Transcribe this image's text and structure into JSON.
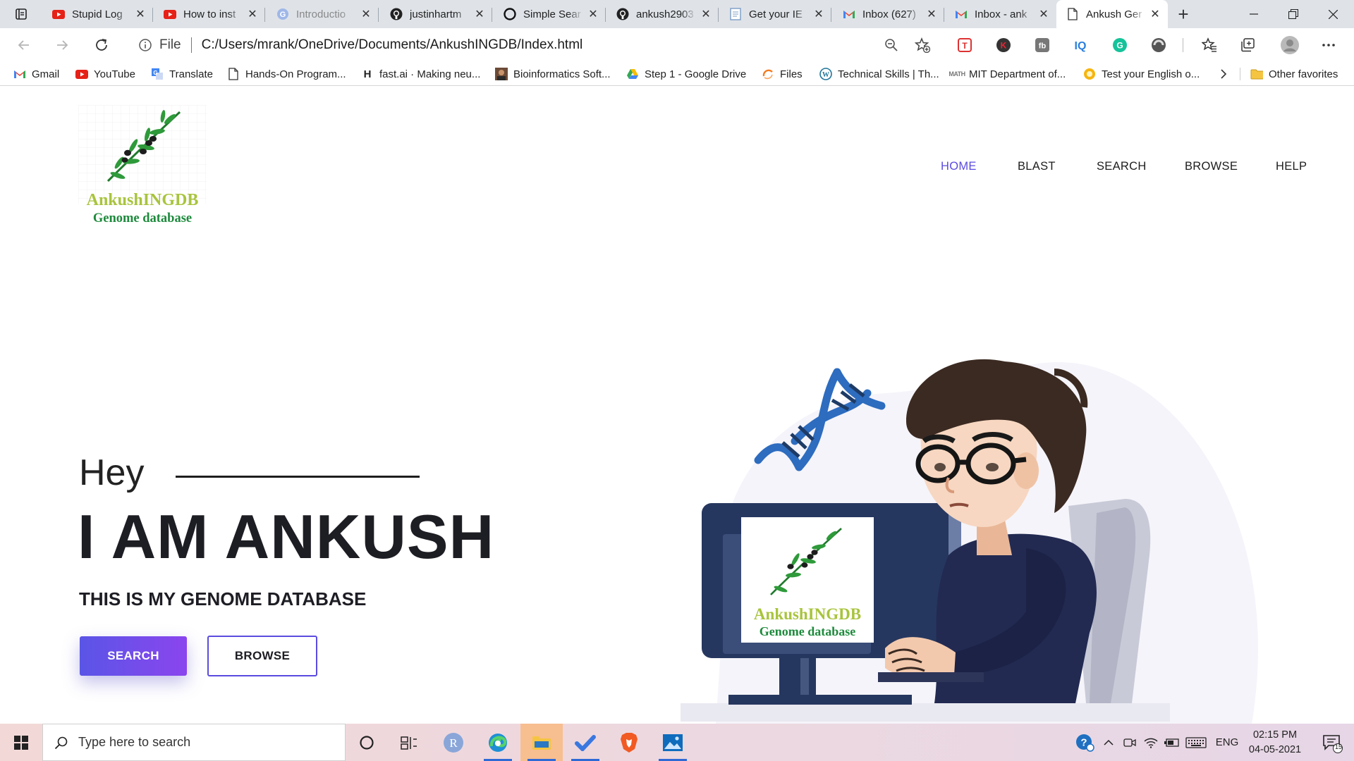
{
  "browser": {
    "tabs": [
      {
        "title": "Stupid Log",
        "icon": "youtube-icon"
      },
      {
        "title": "How to inst",
        "icon": "youtube-icon"
      },
      {
        "title": "Introductio",
        "icon": "google-icon"
      },
      {
        "title": "justinhartm",
        "icon": "github-icon"
      },
      {
        "title": "Simple Sear",
        "icon": "circle-icon"
      },
      {
        "title": "ankush2903",
        "icon": "github-icon"
      },
      {
        "title": "Get your IE",
        "icon": "document-icon"
      },
      {
        "title": "Inbox (627)",
        "icon": "gmail-icon"
      },
      {
        "title": "Inbox - ank",
        "icon": "gmail-icon"
      },
      {
        "title": "Ankush Ger",
        "icon": "page-icon"
      }
    ],
    "active_tab_index": 9,
    "address": {
      "scheme": "File",
      "url": "C:/Users/mrank/OneDrive/Documents/AnkushINGDB/Index.html"
    },
    "bookmarks": [
      {
        "label": "Gmail",
        "icon": "gmail-icon"
      },
      {
        "label": "YouTube",
        "icon": "youtube-icon"
      },
      {
        "label": "Translate",
        "icon": "translate-icon"
      },
      {
        "label": "Hands-On Program...",
        "icon": "page-icon"
      },
      {
        "label": "fast.ai · Making neu...",
        "icon": "hackernews-icon"
      },
      {
        "label": "Bioinformatics Soft...",
        "icon": "avatar-icon"
      },
      {
        "label": "Step 1 - Google Drive",
        "icon": "drive-icon"
      },
      {
        "label": "Files",
        "icon": "files-icon"
      },
      {
        "label": "Technical Skills | Th...",
        "icon": "wordpress-icon"
      },
      {
        "label": "MIT Department of...",
        "icon": "mit-icon"
      },
      {
        "label": "Test your English o...",
        "icon": "sun-icon"
      }
    ],
    "other_favorites": "Other favorites"
  },
  "site": {
    "logo": {
      "line1": "AnkushINGDB",
      "line2": "Genome database"
    },
    "nav": [
      {
        "label": "HOME",
        "active": true
      },
      {
        "label": "BLAST",
        "active": false
      },
      {
        "label": "SEARCH",
        "active": false
      },
      {
        "label": "BROWSE",
        "active": false
      },
      {
        "label": "HELP",
        "active": false
      }
    ],
    "hero": {
      "greeting": "Hey",
      "headline": "I AM ANKUSH",
      "subline": "THIS IS MY GENOME DATABASE",
      "primary_button": "SEARCH",
      "secondary_button": "BROWSE"
    },
    "colors": {
      "accent": "#5b4bdf",
      "accent_gradient_end": "#8b45ee",
      "logo_green": "#a8c43d",
      "logo_dark_green": "#1d8a3c"
    }
  },
  "taskbar": {
    "search_placeholder": "Type here to search",
    "language": "ENG",
    "time": "02:15 PM",
    "date": "04-05-2021",
    "notification_count": "15"
  }
}
